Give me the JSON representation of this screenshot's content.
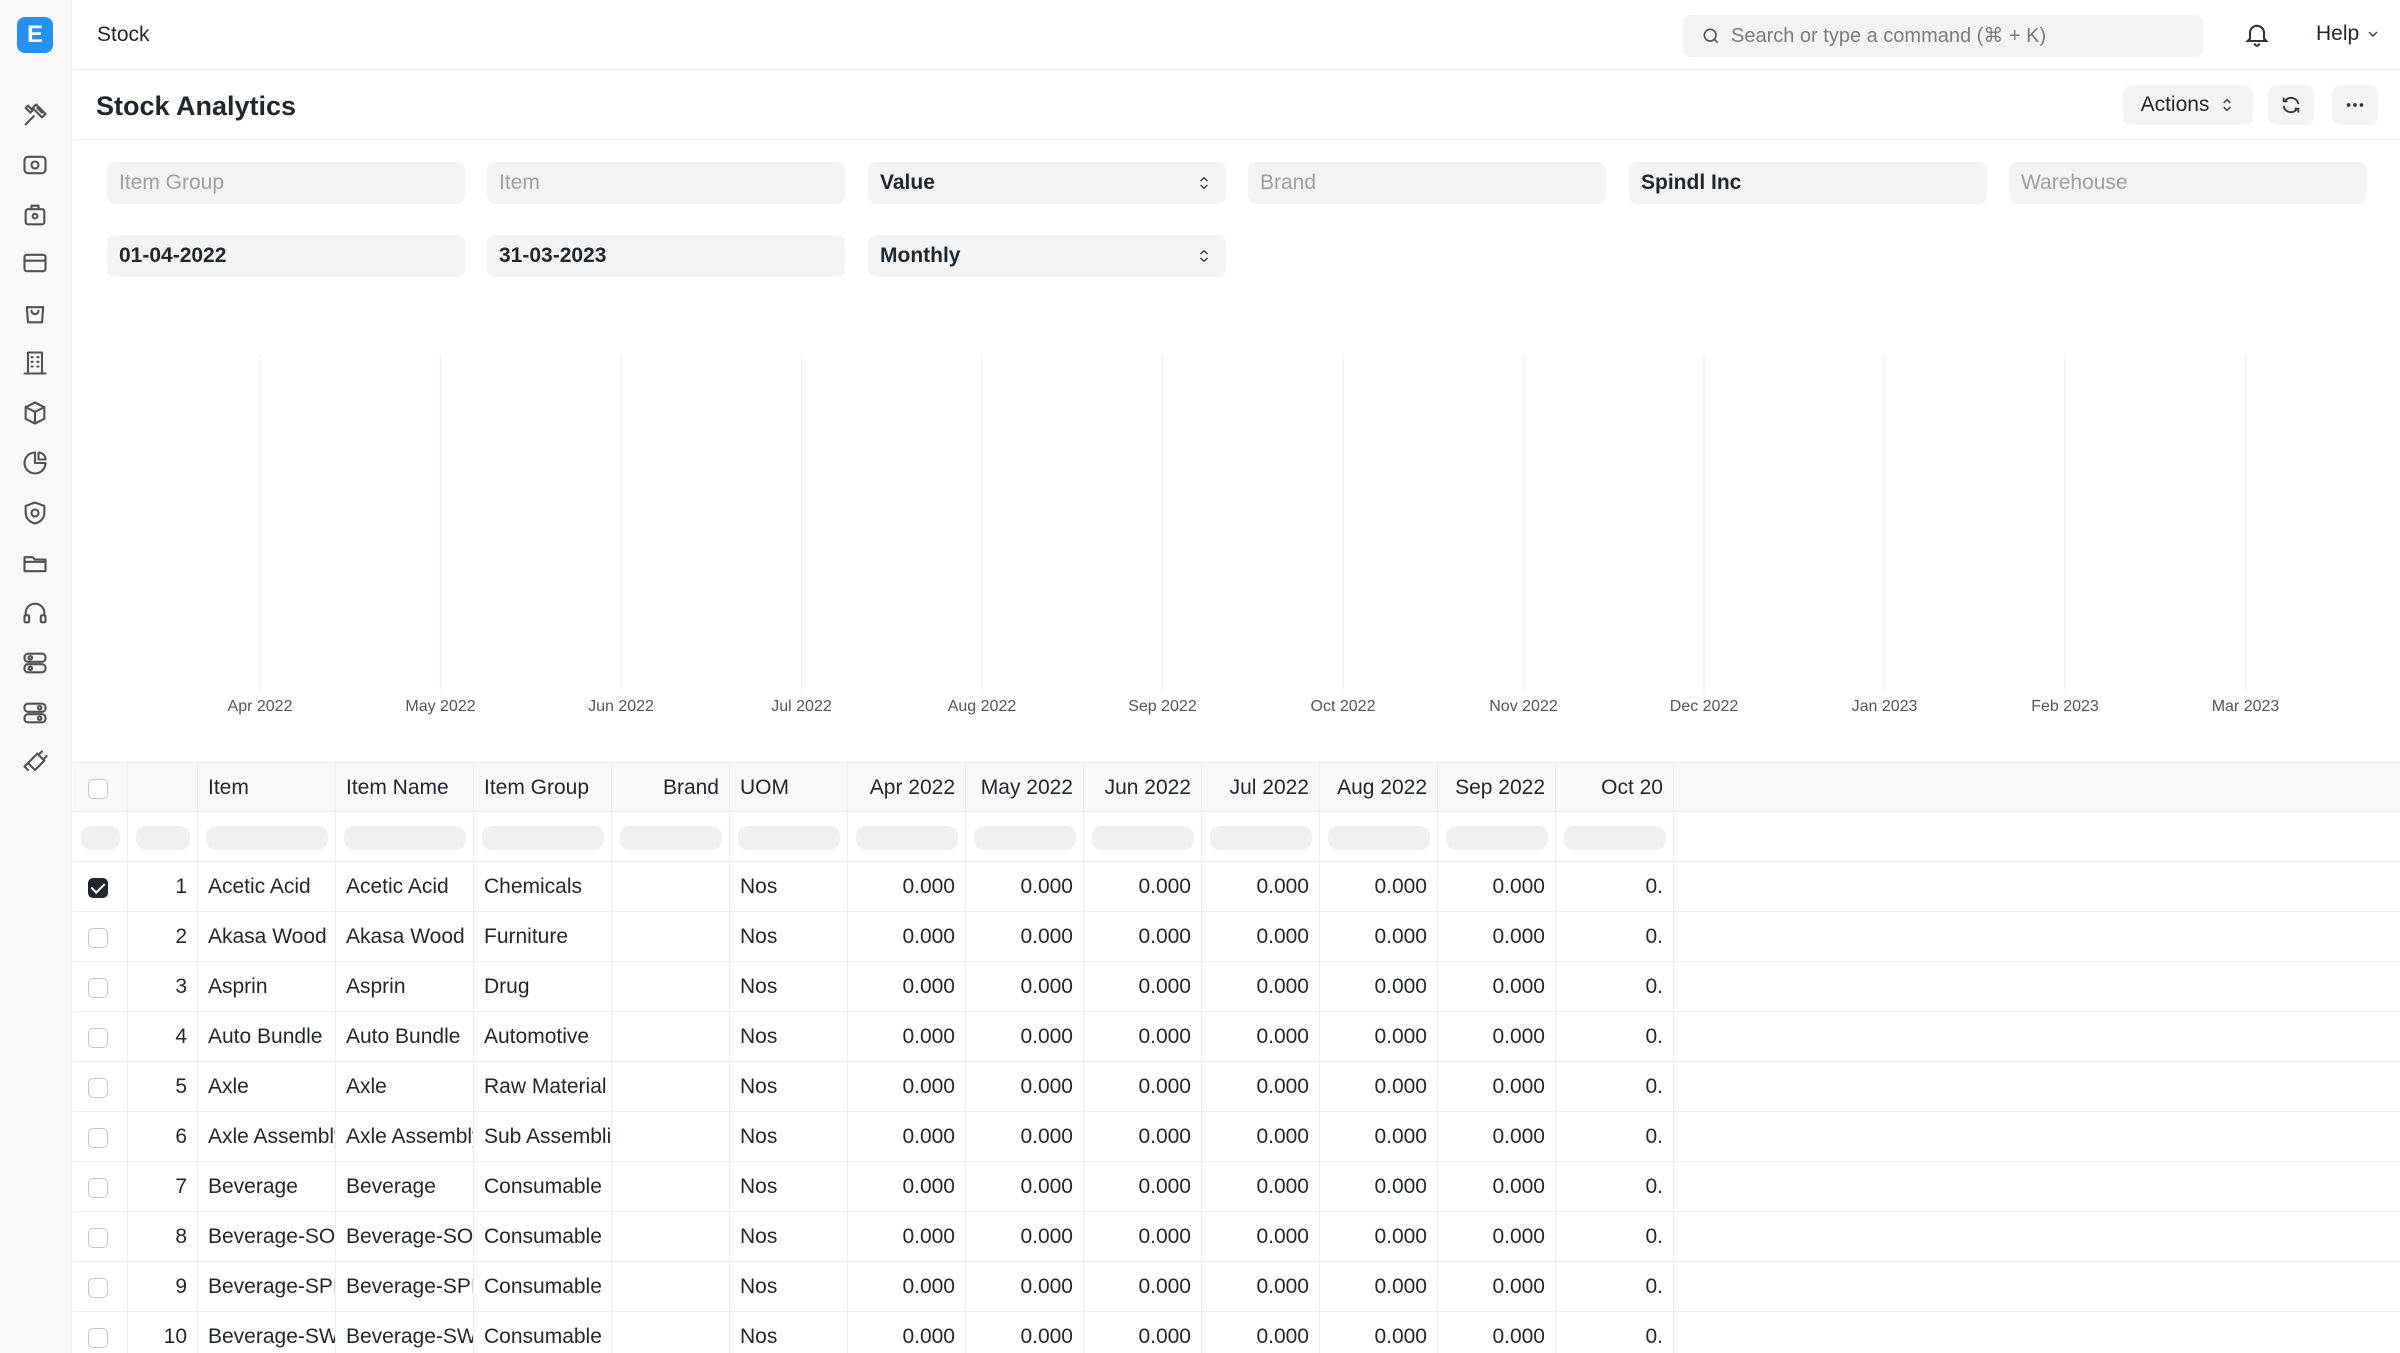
{
  "app": {
    "logo_letter": "E",
    "breadcrumb": "Stock"
  },
  "search": {
    "placeholder": "Search or type a command (⌘ + K)"
  },
  "header": {
    "help_label": "Help"
  },
  "page": {
    "title": "Stock Analytics",
    "actions_label": "Actions"
  },
  "filters": {
    "item_group_placeholder": "Item Group",
    "item_placeholder": "Item",
    "value_type": "Value",
    "brand_placeholder": "Brand",
    "company": "Spindl Inc",
    "warehouse_placeholder": "Warehouse",
    "from_date": "01-04-2022",
    "to_date": "31-03-2023",
    "range": "Monthly"
  },
  "chart_data": {
    "type": "line",
    "categories": [
      "Apr 2022",
      "May 2022",
      "Jun 2022",
      "Jul 2022",
      "Aug 2022",
      "Sep 2022",
      "Oct 2022",
      "Nov 2022",
      "Dec 2022",
      "Jan 2023",
      "Feb 2023",
      "Mar 2023"
    ],
    "series": [],
    "grid": "vertical"
  },
  "table": {
    "columns": [
      "Item",
      "Item Name",
      "Item Group",
      "Brand",
      "UOM",
      "Apr 2022",
      "May 2022",
      "Jun 2022",
      "Jul 2022",
      "Aug 2022",
      "Sep 2022",
      "Oct 20"
    ],
    "rows": [
      {
        "n": "1",
        "item": "Acetic Acid",
        "name": "Acetic Acid",
        "group": "Chemicals",
        "brand": "",
        "uom": "Nos",
        "checked": true,
        "vals": [
          "0.000",
          "0.000",
          "0.000",
          "0.000",
          "0.000",
          "0.000",
          "0."
        ]
      },
      {
        "n": "2",
        "item": "Akasa Wood",
        "name": "Akasa Wood",
        "group": "Furniture",
        "brand": "",
        "uom": "Nos",
        "checked": false,
        "vals": [
          "0.000",
          "0.000",
          "0.000",
          "0.000",
          "0.000",
          "0.000",
          "0."
        ]
      },
      {
        "n": "3",
        "item": "Asprin",
        "name": "Asprin",
        "group": "Drug",
        "brand": "",
        "uom": "Nos",
        "checked": false,
        "vals": [
          "0.000",
          "0.000",
          "0.000",
          "0.000",
          "0.000",
          "0.000",
          "0."
        ]
      },
      {
        "n": "4",
        "item": "Auto Bundle",
        "name": "Auto Bundle",
        "group": "Automotive",
        "brand": "",
        "uom": "Nos",
        "checked": false,
        "vals": [
          "0.000",
          "0.000",
          "0.000",
          "0.000",
          "0.000",
          "0.000",
          "0."
        ]
      },
      {
        "n": "5",
        "item": "Axle",
        "name": "Axle",
        "group": "Raw Material",
        "brand": "",
        "uom": "Nos",
        "checked": false,
        "vals": [
          "0.000",
          "0.000",
          "0.000",
          "0.000",
          "0.000",
          "0.000",
          "0."
        ]
      },
      {
        "n": "6",
        "item": "Axle Assembly",
        "name": "Axle Assembly",
        "group": "Sub Assemblies",
        "brand": "",
        "uom": "Nos",
        "checked": false,
        "vals": [
          "0.000",
          "0.000",
          "0.000",
          "0.000",
          "0.000",
          "0.000",
          "0."
        ]
      },
      {
        "n": "7",
        "item": "Beverage",
        "name": "Beverage",
        "group": "Consumable",
        "brand": "",
        "uom": "Nos",
        "checked": false,
        "vals": [
          "0.000",
          "0.000",
          "0.000",
          "0.000",
          "0.000",
          "0.000",
          "0."
        ]
      },
      {
        "n": "8",
        "item": "Beverage-SOUR",
        "name": "Beverage-SOUR",
        "group": "Consumable",
        "brand": "",
        "uom": "Nos",
        "checked": false,
        "vals": [
          "0.000",
          "0.000",
          "0.000",
          "0.000",
          "0.000",
          "0.000",
          "0."
        ]
      },
      {
        "n": "9",
        "item": "Beverage-SPICY",
        "name": "Beverage-SPICY",
        "group": "Consumable",
        "brand": "",
        "uom": "Nos",
        "checked": false,
        "vals": [
          "0.000",
          "0.000",
          "0.000",
          "0.000",
          "0.000",
          "0.000",
          "0."
        ]
      },
      {
        "n": "10",
        "item": "Beverage-SWEET",
        "name": "Beverage-SWEET",
        "group": "Consumable",
        "brand": "",
        "uom": "Nos",
        "checked": false,
        "vals": [
          "0.000",
          "0.000",
          "0.000",
          "0.000",
          "0.000",
          "0.000",
          "0."
        ]
      }
    ]
  },
  "sidebar": {
    "icons": [
      "tools-icon",
      "accounting-icon",
      "buying-icon",
      "payments-icon",
      "selling-icon",
      "organization-icon",
      "stock-icon",
      "analytics-icon",
      "quality-icon",
      "projects-icon",
      "support-icon",
      "settings-icon",
      "integrations-icon",
      "build-icon"
    ]
  }
}
